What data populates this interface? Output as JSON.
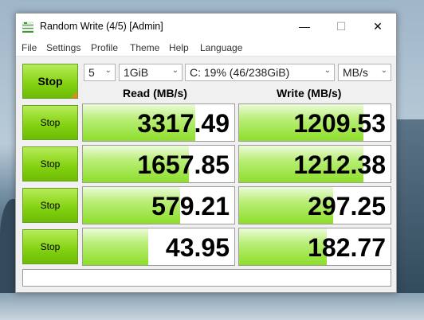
{
  "window": {
    "title": "Random Write (4/5) [Admin]",
    "controls": {
      "minimize": "—",
      "maximize": "☐",
      "close": "✕"
    }
  },
  "menu": [
    "File",
    "Settings",
    "Profile",
    "Theme",
    "Help",
    "Language"
  ],
  "toolbar": {
    "stop_all_label": "Stop",
    "count_value": "5",
    "size_value": "1GiB",
    "drive_value": "C: 19% (46/238GiB)",
    "unit_value": "MB/s"
  },
  "headers": {
    "read": "Read (MB/s)",
    "write": "Write (MB/s)"
  },
  "rows": [
    {
      "stop_label": "Stop",
      "read": "3317.49",
      "write": "1209.53",
      "read_fill": 0.74,
      "write_fill": 0.82
    },
    {
      "stop_label": "Stop",
      "read": "1657.85",
      "write": "1212.38",
      "read_fill": 0.7,
      "write_fill": 0.82
    },
    {
      "stop_label": "Stop",
      "read": "579.21",
      "write": "297.25",
      "read_fill": 0.64,
      "write_fill": 0.62
    },
    {
      "stop_label": "Stop",
      "read": "43.95",
      "write": "182.77",
      "read_fill": 0.43,
      "write_fill": 0.58
    }
  ],
  "comment": "",
  "colors": {
    "accent_green": "#86d314",
    "bar_green": "#8ede2a",
    "flag_orange": "#e8871e"
  }
}
